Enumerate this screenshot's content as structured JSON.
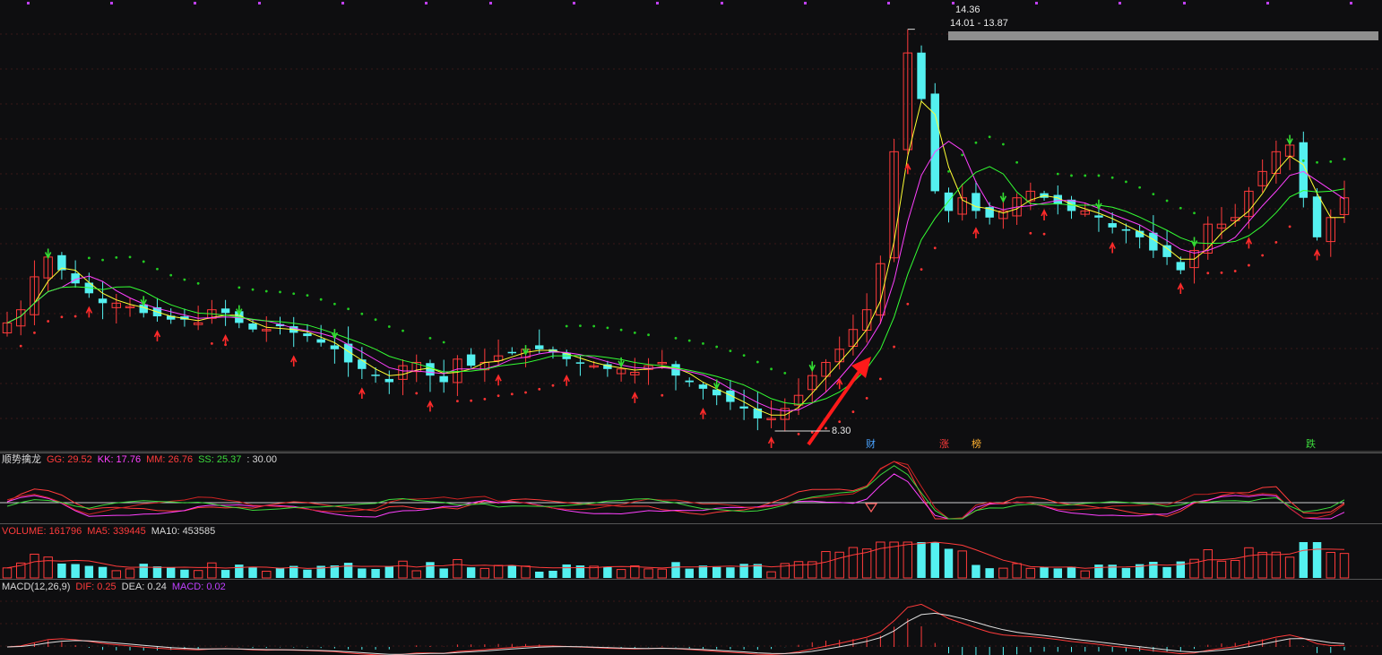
{
  "colors": {
    "bg": "#0e0e10",
    "up": "#ff3b3b",
    "down": "#54f0f0",
    "ma5": "#ffff33",
    "ma10": "#ff40ff",
    "ma20": "#33ff33",
    "sar_up": "#ff3333",
    "sar_down": "#22cc22",
    "grid": "#3a1818",
    "zero": "#cfcfcf"
  },
  "main": {
    "high_label": "14.36",
    "range_label": "14.01 - 13.87",
    "low_label": "8.30",
    "event_tags": [
      {
        "text": "财",
        "color": "#4aa3ff"
      },
      {
        "text": "涨",
        "color": "#ff3b3b"
      },
      {
        "text": "榜",
        "color": "#ffb030"
      },
      {
        "text": "跌",
        "color": "#3cd93c"
      }
    ]
  },
  "indicator1": {
    "name": "顺势擒龙",
    "gg": "GG: 29.52",
    "kk": "KK: 17.76",
    "mm": "MM: 26.76",
    "ss": "SS: 25.37",
    "level": ": 30.00"
  },
  "indicator2": {
    "volume": "VOLUME: 161796",
    "ma5": "MA5: 339445",
    "ma10": "MA10: 453585"
  },
  "indicator3": {
    "name": "MACD(12,26,9)",
    "dif": "DIF: 0.25",
    "dea": "DEA: 0.24",
    "macd": "MACD: 0.02"
  },
  "chart_data": {
    "type": "candlestick",
    "y_range": [
      8.0,
      14.6
    ],
    "high_marker": 14.36,
    "low_marker": 8.3,
    "closes": [
      9.9,
      10.1,
      10.6,
      10.9,
      10.7,
      10.5,
      10.35,
      10.2,
      10.2,
      10.15,
      10.05,
      10.0,
      9.95,
      9.95,
      9.9,
      10.1,
      10.05,
      9.9,
      9.8,
      9.8,
      9.85,
      9.75,
      9.7,
      9.6,
      9.5,
      9.3,
      9.2,
      9.1,
      9.0,
      9.25,
      9.3,
      9.1,
      9.0,
      9.35,
      9.25,
      9.3,
      9.4,
      9.45,
      9.5,
      9.5,
      9.45,
      9.35,
      9.3,
      9.25,
      9.2,
      9.2,
      9.15,
      9.25,
      9.3,
      9.1,
      9.0,
      8.9,
      8.8,
      8.7,
      8.6,
      8.45,
      8.45,
      8.6,
      8.8,
      9.1,
      9.3,
      9.5,
      9.8,
      10.1,
      10.8,
      12.5,
      14.0,
      13.3,
      11.9,
      11.6,
      11.8,
      11.6,
      11.5,
      11.6,
      11.8,
      11.9,
      11.8,
      11.7,
      11.6,
      11.6,
      11.5,
      11.35,
      11.3,
      11.2,
      11.0,
      10.9,
      10.7,
      11.0,
      11.4,
      11.4,
      11.5,
      11.9,
      12.2,
      12.5,
      12.6,
      11.8,
      11.2,
      11.5,
      11.8
    ]
  }
}
